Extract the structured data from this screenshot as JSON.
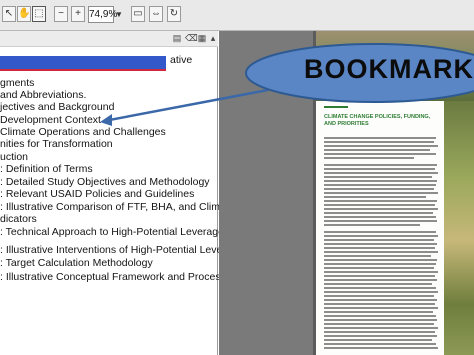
{
  "toolbar": {
    "zoom_value": "74,9%"
  },
  "bookmarks": {
    "items": [
      "ative",
      "gments",
      "and Abbreviations.",
      "jectives and Background",
      "Development  Context",
      "Climate Operations and Challenges",
      "nities  for Transformation",
      "uction",
      ": Definition of Terms",
      ": Detailed Study Objectives and Methodology",
      ": Relevant USAID Policies and Guidelines",
      ": Illustrative Comparison of FTF, BHA, and Climate  Change",
      "dicators",
      ": Technical Approach to High-Potential Leverage Points",
      ": Illustrative Interventions of High-Potential Leverage Points",
      ": Target Calculation Methodology",
      ": Illustrative Conceptual Framework and Process"
    ]
  },
  "callout": {
    "label": "BOOKMARK"
  },
  "document_page": {
    "heading": "CLIMATE CHANGE POLICIES, FUNDING, AND PRIORITIES"
  }
}
